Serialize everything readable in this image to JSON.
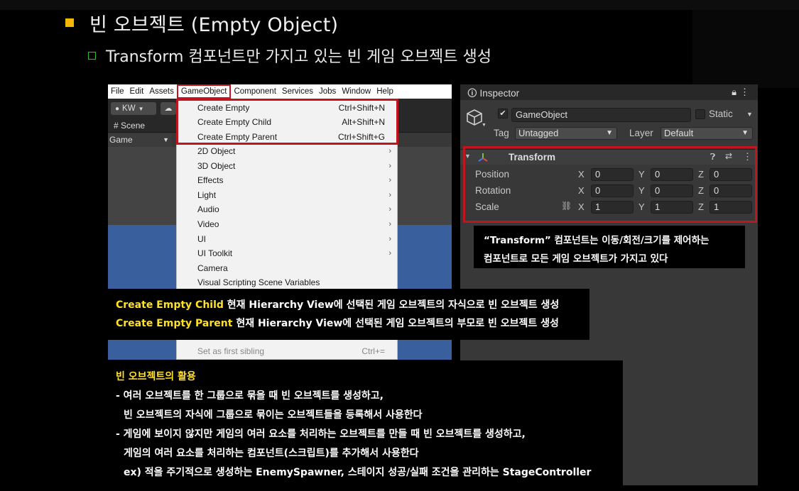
{
  "slide": {
    "title": "빈 오브젝트 (Empty Object)",
    "subtitle": "Transform 컴포넌트만 가지고 있는 빈 게임 오브젝트 생성"
  },
  "menubar": {
    "items": [
      "File",
      "Edit",
      "Assets",
      "GameObject",
      "Component",
      "Services",
      "Jobs",
      "Window",
      "Help"
    ],
    "active_index": 3
  },
  "toolbar": {
    "account_label": "KW",
    "scene_tab": "Scene",
    "game_dropdown": "Game"
  },
  "dropdown": {
    "items": [
      {
        "label": "Create Empty",
        "shortcut": "Ctrl+Shift+N",
        "submenu": false
      },
      {
        "label": "Create Empty Child",
        "shortcut": "Alt+Shift+N",
        "submenu": false
      },
      {
        "label": "Create Empty Parent",
        "shortcut": "Ctrl+Shift+G",
        "submenu": false
      },
      {
        "label": "2D Object",
        "shortcut": "",
        "submenu": true
      },
      {
        "label": "3D Object",
        "shortcut": "",
        "submenu": true
      },
      {
        "label": "Effects",
        "shortcut": "",
        "submenu": true
      },
      {
        "label": "Light",
        "shortcut": "",
        "submenu": true
      },
      {
        "label": "Audio",
        "shortcut": "",
        "submenu": true
      },
      {
        "label": "Video",
        "shortcut": "",
        "submenu": true
      },
      {
        "label": "UI",
        "shortcut": "",
        "submenu": true
      },
      {
        "label": "UI Toolkit",
        "shortcut": "",
        "submenu": true
      },
      {
        "label": "Camera",
        "shortcut": "",
        "submenu": false
      },
      {
        "label": "Visual Scripting Scene Variables",
        "shortcut": "",
        "submenu": false
      }
    ],
    "bottom_item": {
      "label": "Set as first sibling",
      "shortcut": "Ctrl+="
    }
  },
  "inspector": {
    "tab_title": "Inspector",
    "object_name": "GameObject",
    "static_label": "Static",
    "tag_label": "Tag",
    "tag_value": "Untagged",
    "layer_label": "Layer",
    "layer_value": "Default",
    "component_title": "Transform",
    "rows": [
      {
        "label": "Position",
        "x": "0",
        "y": "0",
        "z": "0"
      },
      {
        "label": "Rotation",
        "x": "0",
        "y": "0",
        "z": "0"
      },
      {
        "label": "Scale",
        "x": "1",
        "y": "1",
        "z": "1"
      }
    ],
    "axis_x": "X",
    "axis_y": "Y",
    "axis_z": "Z"
  },
  "callouts": {
    "transform_note_line1": "“Transform” 컴포넌트는 이동/회전/크기를 제어하는",
    "transform_note_line2": "컴포넌트로 모든 게임 오브젝트가 가지고 있다",
    "child_term": "Create Empty Child",
    "child_desc": " 현재 Hierarchy View에 선택된 게임 오브젝트의 자식으로 빈 오브젝트 생성",
    "parent_term": "Create Empty Parent",
    "parent_desc": " 현재 Hierarchy View에 선택된 게임 오브젝트의 부모로 빈 오브젝트 생성",
    "usage_head": "빈 오브젝트의 활용",
    "usage_1a": "- 여러 오브젝트를 한 그룹으로 묶을 때 빈 오브젝트를 생성하고,",
    "usage_1b": "빈 오브젝트의 자식에 그룹으로 묶이는 오브젝트들을 등록해서 사용한다",
    "usage_2a": "- 게임에 보이지 않지만 게임의 여러 요소를 처리하는 오브젝트를 만들 때 빈 오브젝트를 생성하고,",
    "usage_2b": "게임의 여러 요소를 처리하는 컴포넌트(스크립트)를 추가해서 사용한다",
    "usage_ex": "ex) 적을 주기적으로 생성하는 EnemySpawner, 스테이지 성공/실패 조건을 관리하는 StageController"
  },
  "colors": {
    "highlight_red": "#c0141e",
    "accent_yellow": "#ffe02a",
    "bullet_orange": "#f5b800",
    "bullet_green": "#29c229",
    "scene_blue": "#3a5f9d"
  }
}
